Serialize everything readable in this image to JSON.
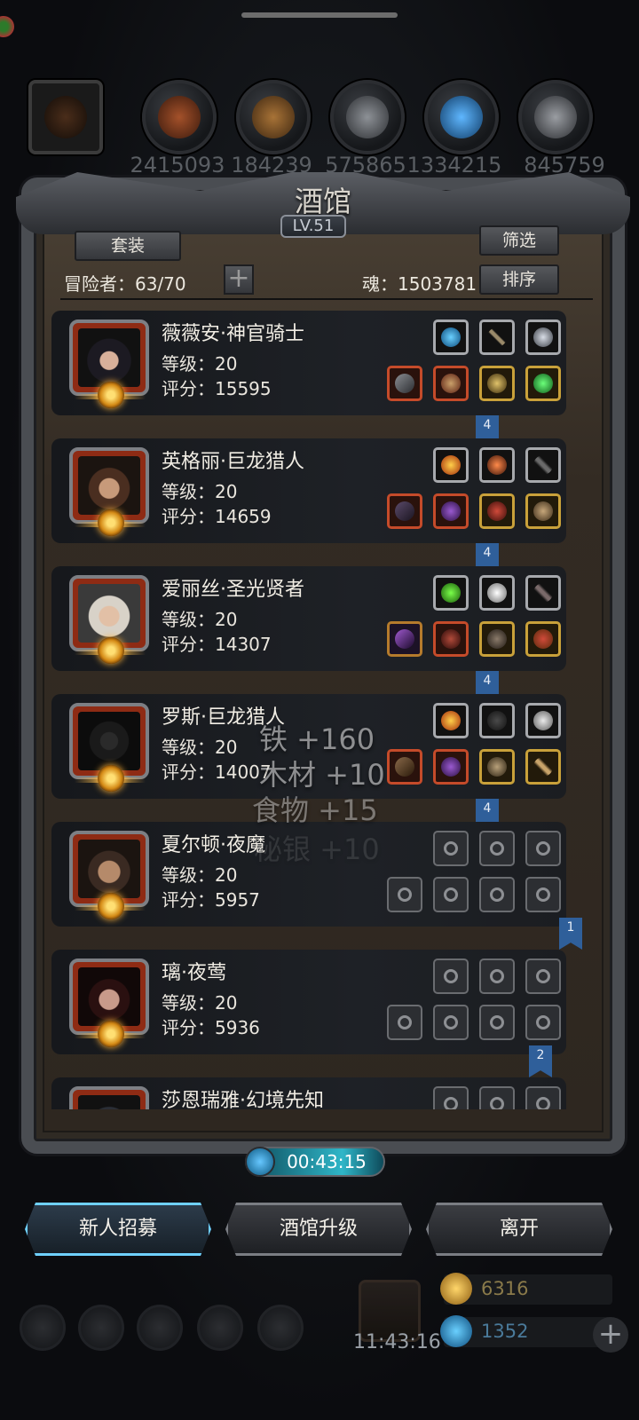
{
  "resources": [
    {
      "icon": "hooded-figure-icon",
      "value": ""
    },
    {
      "icon": "meat-icon",
      "value": "2415093"
    },
    {
      "icon": "wood-icon",
      "value": "184239"
    },
    {
      "icon": "stone-icon",
      "value": "575865"
    },
    {
      "icon": "crystal-icon",
      "value": "1334215"
    },
    {
      "icon": "iron-icon",
      "value": "845759"
    }
  ],
  "panel": {
    "title": "酒馆",
    "level": "LV.51",
    "suit_button": "套装",
    "filter_button": "筛选",
    "sort_button": "排序",
    "adventurers": "冒险者：63/70",
    "plus": "+",
    "soul": "魂：1503781"
  },
  "heroes": [
    {
      "name": "薇薇安·神官骑士",
      "level": "等级：20",
      "score": "评分：15595",
      "ribbon": "4"
    },
    {
      "name": "英格丽·巨龙猎人",
      "level": "等级：20",
      "score": "评分：14659",
      "ribbon": "4"
    },
    {
      "name": "爱丽丝·圣光贤者",
      "level": "等级：20",
      "score": "评分：14307",
      "ribbon": "4"
    },
    {
      "name": "罗斯·巨龙猎人",
      "level": "等级：20",
      "score": "评分：14007",
      "ribbon": "4"
    },
    {
      "name": "夏尔顿·夜魔",
      "level": "等级：20",
      "score": "评分：5957",
      "ribbon": "1"
    },
    {
      "name": "璃·夜莺",
      "level": "等级：20",
      "score": "评分：5936",
      "ribbon": "2"
    },
    {
      "name": "莎恩瑞雅·幻境先知",
      "level": "",
      "score": "",
      "ribbon": ""
    }
  ],
  "floating_gains": [
    "铁 +160",
    "木材 +10",
    "食物 +15",
    "秘银 +10"
  ],
  "timer": "00:43:15",
  "actions": {
    "recruit": "新人招募",
    "upgrade": "酒馆升级",
    "leave": "离开"
  },
  "footer": {
    "clock": "11:43:16",
    "gold": "6316",
    "gems": "1352",
    "add": "+"
  },
  "colors": {
    "accent_blue": "#3fb8ff",
    "ribbon": "#2f5f9a",
    "gold": "#c9a13a"
  }
}
